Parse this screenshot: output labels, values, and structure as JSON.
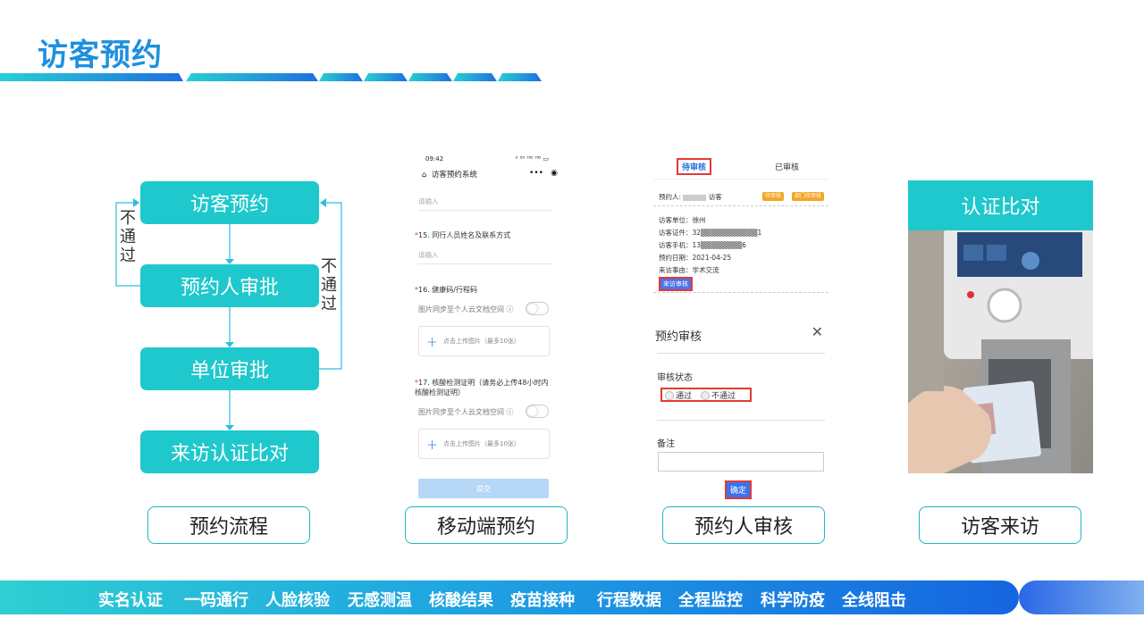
{
  "page": {
    "title": "访客预约"
  },
  "flow": {
    "steps": [
      "访客预约",
      "预约人审批",
      "单位审批",
      "来访认证比对"
    ],
    "reject_label": [
      "不",
      "通",
      "过"
    ]
  },
  "captions": [
    "预约流程",
    "移动端预约",
    "预约人审核",
    "访客来访"
  ],
  "phone": {
    "time": "09:42",
    "signal": "⁰ ⁵⁰ ᴴᴰ ᴴᴰ ▭",
    "app_title": "访客预约系统",
    "field_placeholder_top": "请输入",
    "q15_num": "*",
    "q15": "15. 同行人员姓名及联系方式",
    "q15_placeholder": "请输入",
    "q16": "16. 健康码/行程码",
    "sync_label": "图片同步至个人云文档空间 ⓘ",
    "upload_label": "点击上传图片（最多10张）",
    "q17": "17. 核酸检测证明（请务必上传48小时内核酸检测证明）",
    "submit": "提交"
  },
  "review": {
    "tab_pending": "待审核",
    "tab_done": "已审核",
    "applicant_label": "预约人:",
    "applicant_suffix": "访客",
    "badge1": "待审核",
    "badge2": "部门待审核",
    "rows": [
      "访客单位：徐州",
      "访客证件：32▒▒▒▒▒▒▒▒▒▒▒1",
      "访客手机：13▒▒▒▒▒▒▒▒6",
      "预约日期：2021-04-25",
      "来访事由：学术交流"
    ],
    "visit_btn": "来访审核",
    "modal_title": "预约审核",
    "close": "✕",
    "status_label": "审核状态",
    "opt_pass": "通过",
    "opt_fail": "不通过",
    "remark_label": "备注",
    "ok": "确定"
  },
  "photo": {
    "header": "认证比对"
  },
  "features": [
    "实名认证",
    "一码通行",
    "人脸核验",
    "无感测温",
    "核酸结果",
    "疫苗接种",
    "行程数据",
    "全程监控",
    "科学防疫",
    "全线阻击"
  ]
}
